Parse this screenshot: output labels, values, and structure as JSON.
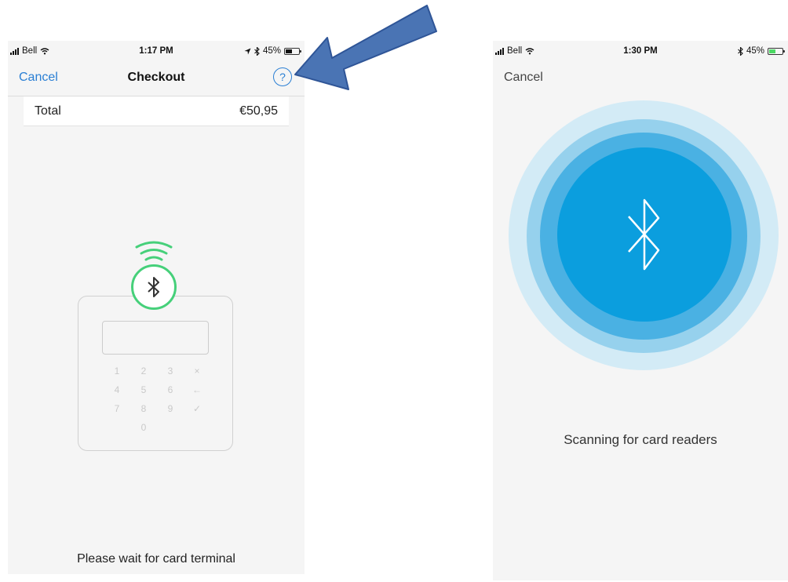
{
  "left_screen": {
    "status": {
      "carrier": "Bell",
      "time": "1:17 PM",
      "battery": "45%"
    },
    "nav": {
      "cancel_label": "Cancel",
      "title": "Checkout",
      "help_label": "?"
    },
    "total": {
      "label": "Total",
      "value": "€50,95"
    },
    "terminal_keys": [
      "1",
      "2",
      "3",
      "×",
      "4",
      "5",
      "6",
      "←",
      "7",
      "8",
      "9",
      "✓",
      "",
      "0",
      "",
      ""
    ],
    "message": "Please wait for card terminal"
  },
  "right_screen": {
    "status": {
      "carrier": "Bell",
      "time": "1:30 PM",
      "battery": "45%"
    },
    "cancel_label": "Cancel",
    "message": "Scanning for card readers"
  },
  "colors": {
    "accent_blue": "#2a7fd4",
    "terminal_green": "#46d07a",
    "scan_blue": "#0b9ede",
    "arrow_blue": "#4a74b4"
  },
  "icons": {
    "bluetooth": "bluetooth-icon",
    "wifi": "wifi-icon",
    "help": "help-icon",
    "arrow": "arrow-icon"
  }
}
